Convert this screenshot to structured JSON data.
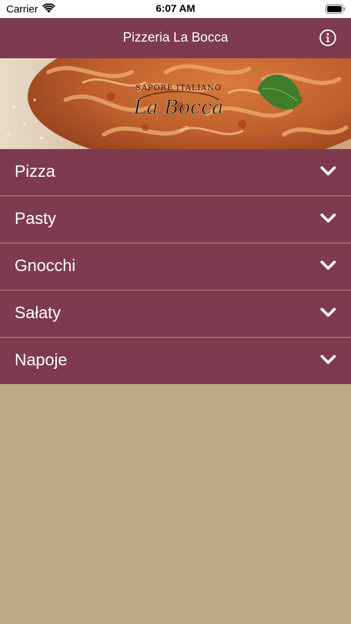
{
  "status_bar": {
    "carrier": "Carrier",
    "time": "6:07 AM",
    "icons": [
      "wifi-icon",
      "battery-icon"
    ]
  },
  "nav": {
    "title": "Pizzeria La Bocca",
    "info_icon": "info-icon"
  },
  "banner": {
    "logo_text_top": "SAPORE ITALIANO",
    "logo_text_main": "La Bocca"
  },
  "menu": {
    "items": [
      {
        "label": "Pizza",
        "icon": "chevron-down-icon"
      },
      {
        "label": "Pasty",
        "icon": "chevron-down-icon"
      },
      {
        "label": "Gnocchi",
        "icon": "chevron-down-icon"
      },
      {
        "label": "Sałaty",
        "icon": "chevron-down-icon"
      },
      {
        "label": "Napoje",
        "icon": "chevron-down-icon"
      }
    ]
  },
  "colors": {
    "accent": "#7e3b4f",
    "background": "#bda888",
    "divider": "#b58a76",
    "text_on_accent": "#ffffff"
  }
}
